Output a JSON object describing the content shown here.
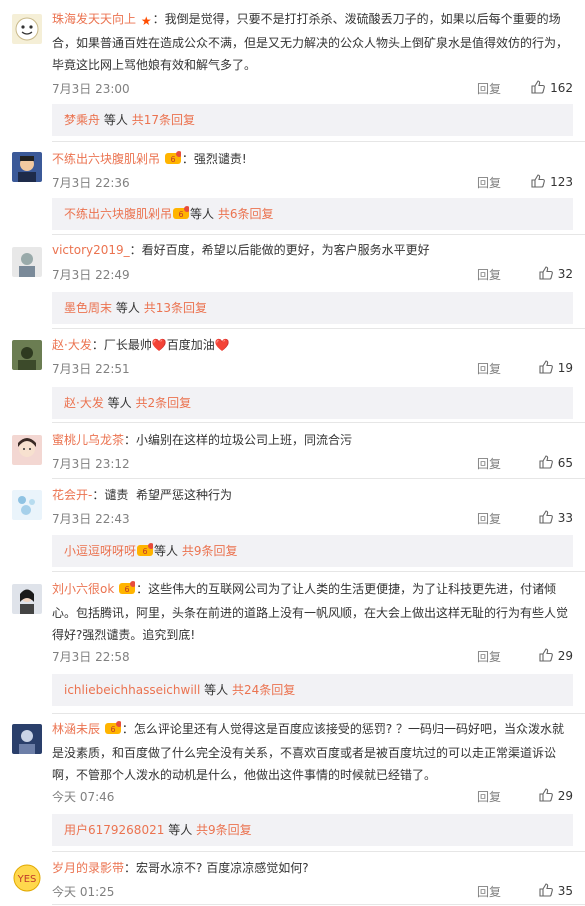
{
  "colors": {
    "accent": "#eb7350",
    "subbox": "#f2f2f5"
  },
  "comments": [
    {
      "user": "珠海发天天向上",
      "badge": "star",
      "text": "我倒是觉得，只要不是打打杀杀、泼硫酸丢刀子的，如果以后每个重要的场合，如果普通百姓在造成公众不满，但是又无力解决的公众人物头上倒矿泉水是值得效仿的行为，毕竟这比网上骂他娘有效和解气多了。",
      "lines": [
        "我倒是觉得，只要不是打打杀杀、泼硫酸丢刀子的，如果以后每个重要的场",
        "合，如果普通百姓在造成公众不满，但是又无力解决的公众人物头上倒矿泉水是值得效仿的行为，",
        "毕竟这比网上骂他娘有效和解气多了。"
      ],
      "time": "7月3日 23:00",
      "reply": "回复",
      "likes": "162",
      "sub_user": "梦乘舟",
      "sub_sep": "等人",
      "sub_total": "共17条回复"
    },
    {
      "user": "不练出六块腹肌剁吊",
      "badge": "vip",
      "text": "强烈谴责!",
      "time": "7月3日 22:36",
      "reply": "回复",
      "likes": "123",
      "sub_user": "不练出六块腹肌剁吊",
      "sub_badge": "vip",
      "sub_sep": "等人",
      "sub_total": "共6条回复"
    },
    {
      "user": "victory2019_",
      "text": "看好百度，希望以后能做的更好，为客户服务水平更好",
      "time": "7月3日 22:49",
      "reply": "回复",
      "likes": "32",
      "sub_user": "墨色周末",
      "sub_sep": "等人",
      "sub_total": "共13条回复"
    },
    {
      "user": "赵·大发",
      "text": "厂长最帅❤️百度加油❤️",
      "time": "7月3日 22:51",
      "reply": "回复",
      "likes": "19",
      "sub_user": "赵·大发",
      "sub_sep": "等人",
      "sub_total": "共2条回复"
    },
    {
      "user": "蜜桃儿乌龙茶",
      "text": "小编别在这样的垃圾公司上班，同流合污",
      "time": "7月3日 23:12",
      "reply": "回复",
      "likes": "65"
    },
    {
      "user": "花会开-",
      "text": "谴责  希望严惩这种行为",
      "time": "7月3日 22:43",
      "reply": "回复",
      "likes": "33",
      "sub_user": "小逗逗呀呀呀",
      "sub_badge": "vip",
      "sub_sep": "等人",
      "sub_total": "共9条回复"
    },
    {
      "user": "刘小六很ok",
      "badge": "vip",
      "text": "这些伟大的互联网公司为了让人类的生活更便捷，为了让科技更先进，付诸倾心。包括腾讯，阿里，头条在前进的道路上没有一帆风顺，在大会上做出这样无耻的行为有些人觉得好?强烈谴责。追究到底!",
      "lines": [
        "这些伟大的互联网公司为了让人类的生活更便捷，为了让科技更先进，付诸倾",
        "心。包括腾讯，阿里，头条在前进的道路上没有一帆风顺，在大会上做出这样无耻的行为有些人觉",
        "得好?强烈谴责。追究到底!"
      ],
      "time": "7月3日 22:58",
      "reply": "回复",
      "likes": "29",
      "sub_user": "ichliebeichhasseichwill",
      "sub_sep": "等人",
      "sub_total": "共24条回复"
    },
    {
      "user": "林涵未辰",
      "badge": "vip",
      "text": "怎么评论里还有人觉得这是百度应该接受的惩罚? ？一码归一码好吧，当众泼水就是没素质，和百度做了什么完全没有关系，不喜欢百度或者是被百度坑过的可以走正常渠道诉讼啊，不管那个人泼水的动机是什么，他做出这件事情的时候就已经错了。",
      "lines": [
        "怎么评论里还有人觉得这是百度应该接受的惩罚? ？一码归一码好吧，当众泼水就",
        "是没素质，和百度做了什么完全没有关系，不喜欢百度或者是被百度坑过的可以走正常渠道诉讼",
        "啊，不管那个人泼水的动机是什么，他做出这件事情的时候就已经错了。"
      ],
      "time": "今天 07:46",
      "reply": "回复",
      "likes": "29",
      "sub_user": "用户6179268021",
      "sub_sep": "等人",
      "sub_total": "共9条回复"
    },
    {
      "user": "岁月的录影带",
      "text": "宏哥水凉不? 百度凉凉感觉如何?",
      "time": "今天 01:25",
      "reply": "回复",
      "likes": "35"
    }
  ]
}
